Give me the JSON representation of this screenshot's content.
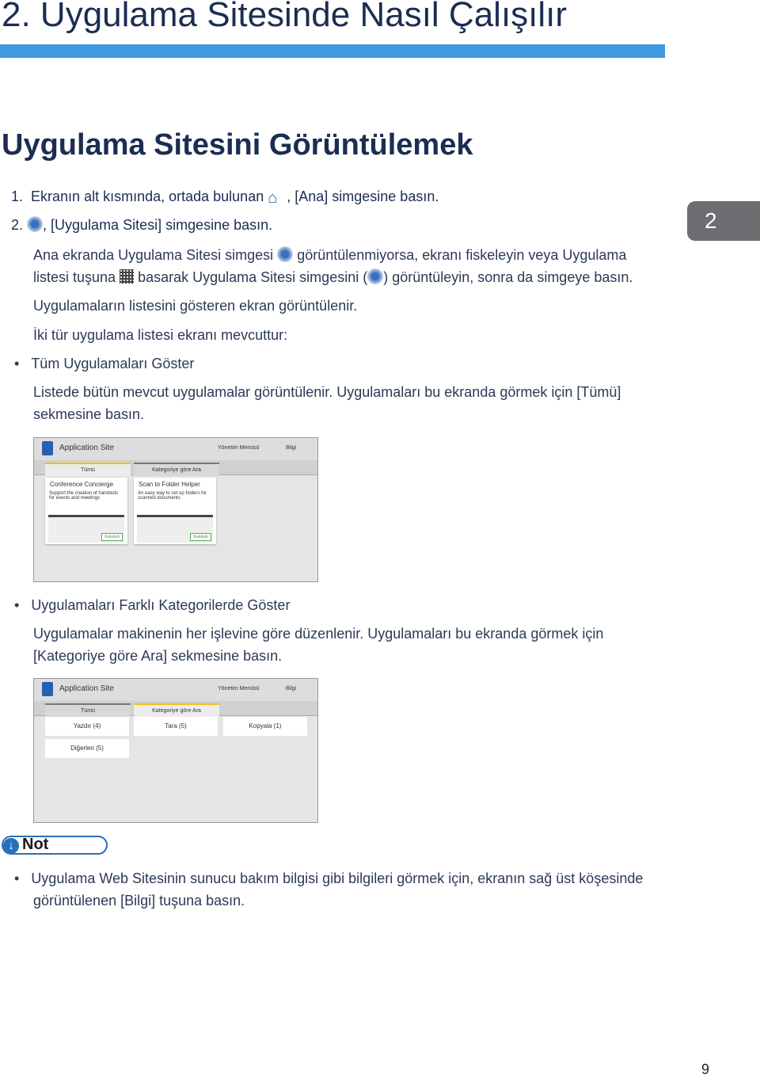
{
  "chapter_title": "2. Uygulama Sitesinde Nasıl Çalışılır",
  "chapter_tab": "2",
  "section_title": "Uygulama Sitesini Görüntülemek",
  "steps": [
    {
      "num": "1.",
      "before": "Ekranın alt kısmında, ortada bulunan",
      "after": ", [Ana] simgesine basın."
    },
    {
      "num": "2.",
      "after": ", [Uygulama Sitesi] simgesine basın."
    }
  ],
  "para1": {
    "a": "Ana ekranda Uygulama Sitesi simgesi",
    "b": "görüntülenmiyorsa, ekranı fiskeleyin veya Uygulama",
    "c": "listesi tuşuna",
    "d": "basarak Uygulama Sitesi simgesini (",
    "e": ") görüntüleyin, sonra da simgeye basın."
  },
  "para2": "Uygulamaların listesini gösteren ekran görüntülenir.",
  "para3": "İki tür uygulama listesi ekranı mevcuttur:",
  "bullet1": {
    "title": "Tüm Uygulamaları Göster",
    "line1": "Listede bütün mevcut uygulamalar görüntülenir. Uygulamaları bu ekranda görmek için [Tümü]",
    "line2": "sekmesine basın."
  },
  "bullet2": {
    "title": "Uygulamaları Farklı Kategorilerde Göster",
    "line1": "Uygulamalar makinenin her işlevine göre düzenlenir. Uygulamaları bu ekranda görmek için",
    "line2": "[Kategoriye göre Ara] sekmesine basın."
  },
  "shot": {
    "app_title": "Application Site",
    "menu1": "Yönetim Menüsü",
    "menu2": "Bilgi",
    "tab_all": "Tümü",
    "tab_cat": "Kategoriye göre Ara",
    "cards": [
      {
        "title": "Conference Concierge",
        "desc": "Support the creation of handouts for events and meetings",
        "btn": "Kurulum"
      },
      {
        "title": "Scan to Folder Helper",
        "desc": "An easy way to set up folders for scanned documents",
        "btn": "Kurulum"
      }
    ],
    "categories": [
      "Yazdır (4)",
      "Tara (5)",
      "Kopyala (1)",
      "Diğerleri (5)"
    ]
  },
  "note": {
    "label": "Not",
    "line1": "Uygulama Web Sitesinin sunucu bakım bilgisi gibi bilgileri görmek için, ekranın sağ üst köşesinde",
    "line2": "görüntülenen [Bilgi] tuşuna basın."
  },
  "page_number": "9"
}
